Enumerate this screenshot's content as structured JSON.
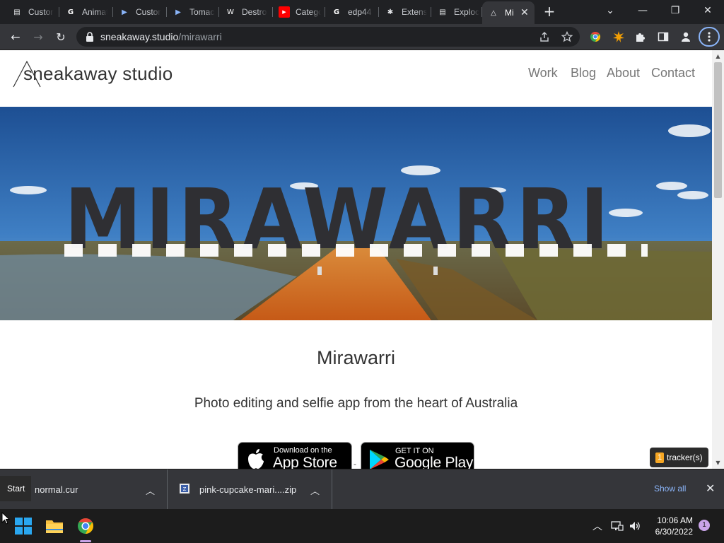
{
  "browser": {
    "tabs": [
      {
        "title": "Custon",
        "icon": "doc-favicon",
        "color": "#e8eaed"
      },
      {
        "title": "Animat",
        "icon": "google-favicon",
        "color": "#ffffff"
      },
      {
        "title": "Custon",
        "icon": "play-favicon",
        "color": "#8ab4f8"
      },
      {
        "title": "Tomaco",
        "icon": "play-favicon",
        "color": "#8ab4f8"
      },
      {
        "title": "Destro",
        "icon": "wikipedia-favicon",
        "color": "#ffffff"
      },
      {
        "title": "Catego",
        "icon": "youtube-favicon",
        "color": "#ff0000"
      },
      {
        "title": "edp44",
        "icon": "google-favicon",
        "color": "#ffffff"
      },
      {
        "title": "Extens",
        "icon": "puzzle-favicon",
        "color": "#e8eaed"
      },
      {
        "title": "Exploc",
        "icon": "doc-favicon",
        "color": "#e8eaed"
      },
      {
        "title": "Mi",
        "icon": "sneakaway-favicon",
        "color": "#e8eaed",
        "active": true
      }
    ],
    "new_tab": "+",
    "window_controls": {
      "dropdown": "⌄",
      "minimize": "—",
      "restore": "❐",
      "close": "✕"
    },
    "toolbar": {
      "back": "←",
      "forward": "→",
      "reload": "↻"
    },
    "url_host": "sneakaway.studio",
    "url_path": "/mirawarri"
  },
  "site": {
    "logo": "sneakaway studio",
    "nav": [
      "Work",
      "Blog",
      "About",
      "Contact"
    ],
    "hero_text": "MIRAWARRI",
    "title": "Mirawarri",
    "subtitle": "Photo editing and selfie app from the heart of Australia",
    "app_store": {
      "small": "Download on the",
      "big": "App Store"
    },
    "google_play": {
      "small": "GET IT ON",
      "big": "Google Play"
    },
    "separator": "-",
    "trackers": {
      "count": "1",
      "label": "tracker(s)"
    }
  },
  "downloads": {
    "items": [
      {
        "name": "normal.cur"
      },
      {
        "name": "pink-cupcake-mari....zip"
      }
    ],
    "show_all": "Show all",
    "tooltip": "Start"
  },
  "taskbar": {
    "time": "10:06 AM",
    "date": "6/30/2022",
    "notifications": "1"
  }
}
